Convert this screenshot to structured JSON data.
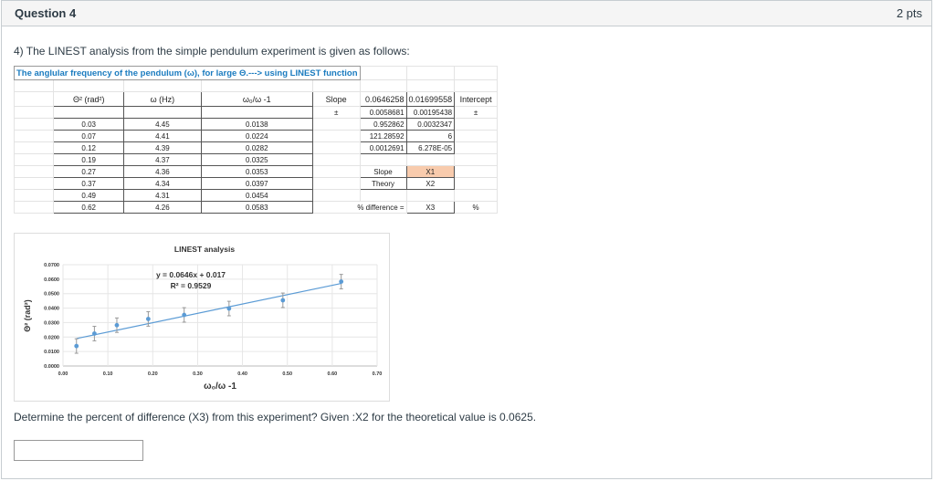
{
  "question": {
    "title": "Question 4",
    "points": "2 pts",
    "text": "4) The LINEST analysis from the simple pendulum experiment is given as follows:",
    "prompt": "Determine the percent of difference (X3) from this experiment? Given :X2 for the theoretical value is 0.0625.",
    "answer_value": ""
  },
  "sheet": {
    "title": "The anglular frequency of the pendulum (ω), for large Θ.---> using LINEST function",
    "headers": [
      "Θ² (rad²)",
      "ω (Hz)",
      "ω₀/ω -1"
    ],
    "rows": [
      [
        "0.03",
        "4.45",
        "0.0138"
      ],
      [
        "0.07",
        "4.41",
        "0.0224"
      ],
      [
        "0.12",
        "4.39",
        "0.0282"
      ],
      [
        "0.19",
        "4.37",
        "0.0325"
      ],
      [
        "0.27",
        "4.36",
        "0.0353"
      ],
      [
        "0.37",
        "4.34",
        "0.0397"
      ],
      [
        "0.49",
        "4.31",
        "0.0454"
      ],
      [
        "0.62",
        "4.26",
        "0.0583"
      ]
    ],
    "linest": {
      "slope_label": "Slope",
      "pm": "±",
      "intercept_label": "Intercept",
      "values": [
        [
          "0.0646258",
          "0.01699558"
        ],
        [
          "0.0058681",
          "0.00195438"
        ],
        [
          "0.952862",
          "0.0032347"
        ],
        [
          "121.28592",
          "6"
        ],
        [
          "0.0012691",
          "6.278E-05"
        ]
      ]
    },
    "compare": {
      "slope_label": "Slope",
      "slope_value": "X1",
      "theory_label": "Theory",
      "theory_value": "X2",
      "diff_label": "% difference =",
      "diff_value": "X3",
      "diff_unit": "%"
    },
    "highlight_color": "#f8cbad"
  },
  "chart_data": {
    "type": "scatter",
    "title": "LINEST analysis",
    "xlabel": "ω₀/ω -1",
    "ylabel": "Θ² (rad²)",
    "x": [
      0.03,
      0.07,
      0.12,
      0.19,
      0.27,
      0.37,
      0.49,
      0.62
    ],
    "y": [
      0.0138,
      0.0224,
      0.0282,
      0.0325,
      0.0353,
      0.0397,
      0.0454,
      0.0583
    ],
    "error": 0.005,
    "trendline": {
      "slope": 0.0646,
      "intercept": 0.017,
      "equation": "y = 0.0646x + 0.017",
      "r2": "R² = 0.9529"
    },
    "xlim": [
      0,
      0.7
    ],
    "ylim": [
      0,
      0.07
    ],
    "xticks": [
      "0.00",
      "0.10",
      "0.20",
      "0.30",
      "0.40",
      "0.50",
      "0.60",
      "0.70"
    ],
    "yticks": [
      "0.0000",
      "0.0100",
      "0.0200",
      "0.0300",
      "0.0400",
      "0.0500",
      "0.0600",
      "0.0700"
    ],
    "grid": true,
    "color": "#5b9bd5"
  }
}
